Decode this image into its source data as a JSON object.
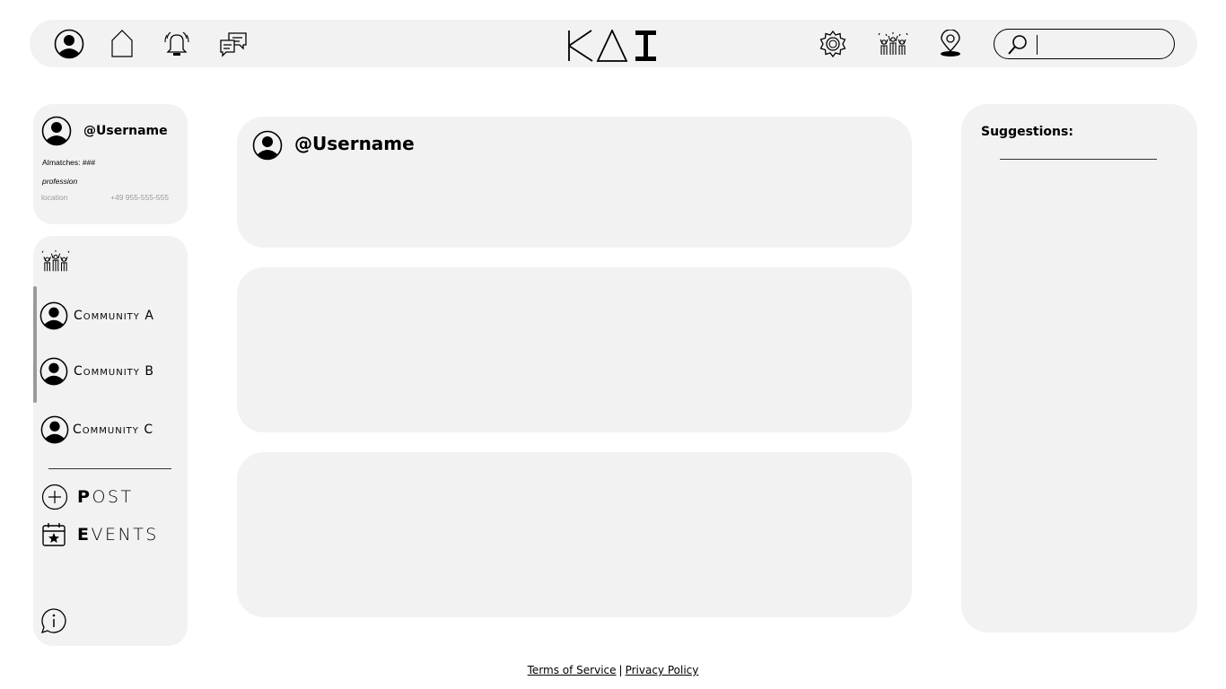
{
  "topbar": {
    "icons": {
      "profile": "user-avatar-icon",
      "home": "home-icon",
      "notifications": "bell-icon",
      "messages": "chat-bubbles-icon",
      "settings": "gear-icon",
      "community": "celebrating-group-icon",
      "location": "map-pin-icon",
      "search": "magnifier-icon"
    },
    "search": {
      "value": "",
      "placeholder": ""
    }
  },
  "profile_card": {
    "username": "@Username",
    "matches": "AImatches: ###",
    "profession": "profession",
    "location": "location",
    "phone": "+49 955-555-555"
  },
  "communities": {
    "header_icon": "celebrating-group-icon",
    "items": [
      {
        "label": "Community A"
      },
      {
        "label": "Community B"
      },
      {
        "label": "Community C"
      }
    ]
  },
  "nav": {
    "post": {
      "first": "P",
      "rest": "OST"
    },
    "events": {
      "first": "E",
      "rest": "VENTS"
    },
    "info_icon": "info-bubble-icon"
  },
  "feed": {
    "posts": [
      {
        "username": "@Username"
      },
      {
        "username": ""
      },
      {
        "username": ""
      }
    ]
  },
  "suggestions": {
    "title": "Suggestions:"
  },
  "footer": {
    "terms": "Terms of Service",
    "separator": "|",
    "privacy": "Privacy Policy"
  },
  "colors": {
    "panel_bg": "#f2f2f2",
    "page_bg": "#ffffff",
    "ink": "#000000"
  }
}
